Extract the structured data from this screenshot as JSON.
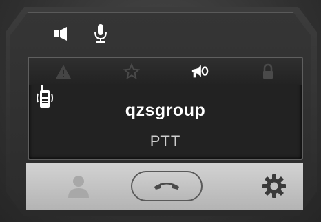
{
  "top_icons": [
    {
      "icon": "speaker-icon"
    },
    {
      "icon": "microphone-icon"
    }
  ],
  "status_icons": [
    {
      "icon": "warning-icon",
      "active": false
    },
    {
      "icon": "star-icon",
      "active": false
    },
    {
      "icon": "broadcast-megaphone-icon",
      "active": true
    },
    {
      "icon": "lock-icon",
      "active": false
    }
  ],
  "call": {
    "group_name": "qzsgroup",
    "mode": "PTT"
  },
  "toolbar": {
    "buttons": [
      {
        "icon": "user-icon",
        "enabled": false
      },
      {
        "icon": "hangup-icon",
        "enabled": true
      },
      {
        "icon": "gear-icon",
        "enabled": true
      }
    ]
  },
  "colors": {
    "screen_bg": "#222222",
    "toolbar_bg": "#c4c4c4",
    "text_primary": "#ffffff",
    "text_secondary": "#cfcfcf",
    "icon_dim": "#5a5a5a"
  }
}
